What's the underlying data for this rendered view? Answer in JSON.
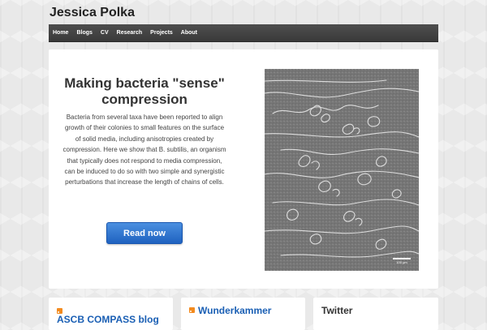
{
  "site": {
    "title": "Jessica Polka"
  },
  "nav": {
    "items": [
      "Home",
      "Blogs",
      "CV",
      "Research",
      "Projects",
      "About"
    ]
  },
  "hero": {
    "title": "Making bacteria \"sense\" compression",
    "body": "Bacteria from several taxa have been reported to align growth of their colonies to small features on the surface of solid media, including anisotropies created by compression. Here we show that B. subtilis, an organism that typically does not respond to media compression, can be induced to do so with two simple and synergistic perturbations that increase the length of chains of cells.",
    "button": "Read now",
    "image_scale_label": "100 μm"
  },
  "widgets": [
    {
      "title": "ASCB COMPASS blog",
      "icon": "rss-icon"
    },
    {
      "title": "Wunderkammer",
      "icon": "rss-icon"
    },
    {
      "title": "Twitter"
    }
  ],
  "colors": {
    "nav_bg": "#444444",
    "button": "#2a6fd0",
    "link": "#1a5fb4"
  }
}
